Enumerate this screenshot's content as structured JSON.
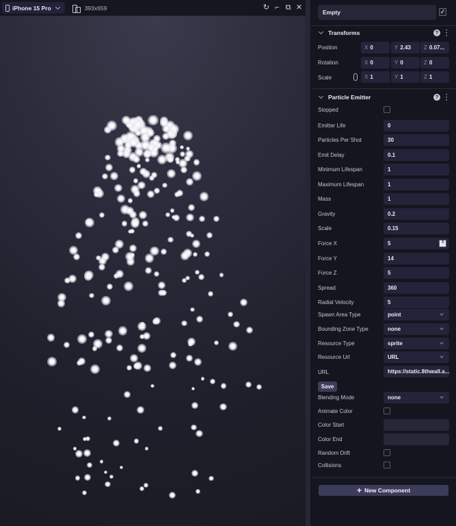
{
  "viewport": {
    "device": "iPhone 15 Pro",
    "resolution": "393x659",
    "actions": [
      {
        "name": "refresh-icon",
        "glyph": "↻"
      },
      {
        "name": "collapse-icon",
        "glyph": "⌐"
      },
      {
        "name": "popout-icon",
        "glyph": "⧉"
      },
      {
        "name": "close-icon",
        "glyph": "✕"
      }
    ]
  },
  "entity": {
    "name": "Empty",
    "enabled": true,
    "check_glyph": "✓"
  },
  "transforms": {
    "title": "Transforms",
    "rows": [
      {
        "label": "Position",
        "x": "0",
        "y": "2.43",
        "z": "0.07..."
      },
      {
        "label": "Rotation",
        "x": "0",
        "y": "0",
        "z": "0"
      },
      {
        "label": "Scale",
        "x": "1",
        "y": "1",
        "z": "1"
      }
    ],
    "axes": [
      "X",
      "Y",
      "Z"
    ]
  },
  "particle_emitter": {
    "title": "Particle Emitter",
    "stopped_label": "Stopped",
    "fields": [
      {
        "label": "Emitter Life",
        "value": "0"
      },
      {
        "label": "Particles Per Shot",
        "value": "30"
      },
      {
        "label": "Emit Delay",
        "value": "0.1"
      },
      {
        "label": "Minimum Lifespan",
        "value": "1"
      },
      {
        "label": "Maximum Lifespan",
        "value": "1"
      },
      {
        "label": "Mass",
        "value": "1"
      },
      {
        "label": "Gravity",
        "value": "0.2"
      },
      {
        "label": "Scale",
        "value": "0.15"
      },
      {
        "label": "Force X",
        "value": "5"
      },
      {
        "label": "Force Y",
        "value": "14"
      },
      {
        "label": "Force Z",
        "value": "5"
      },
      {
        "label": "Spread",
        "value": "360"
      },
      {
        "label": "Radial Velocity",
        "value": "5"
      }
    ],
    "selects": [
      {
        "label": "Spawn Area Type",
        "value": "point"
      },
      {
        "label": "Bounding Zone Type",
        "value": "none"
      },
      {
        "label": "Resource Type",
        "value": "sprite"
      },
      {
        "label": "Resource Url",
        "value": "URL"
      }
    ],
    "url_label": "URL",
    "url_value": "https://static.8thwall.a...",
    "save_label": "Save",
    "blending_label": "Blending Mode",
    "blending_value": "none",
    "animate_color_label": "Animate Color",
    "color_start_label": "Color Start",
    "color_end_label": "Color End",
    "random_drift_label": "Random Drift",
    "collisions_label": "Collisions",
    "stopped": false,
    "animate_color": false,
    "random_drift": false,
    "collisions": false
  },
  "new_component_label": "New Component",
  "help_glyph": "?",
  "kebab_glyph": "⋮",
  "plus_glyph": "+",
  "spinner_glyph": "⇕"
}
